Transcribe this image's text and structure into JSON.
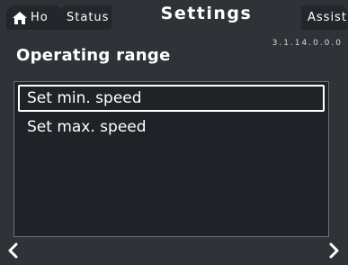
{
  "tabs": {
    "home": "Ho",
    "status": "Status",
    "settings": "Settings",
    "assist": "Assist"
  },
  "version": "3.1.14.0.0.0",
  "page_title": "Operating range",
  "menu_items": [
    {
      "label": "Set min. speed",
      "selected": true
    },
    {
      "label": "Set max. speed",
      "selected": false
    }
  ],
  "icons": {
    "home": "home-icon",
    "back": "chevron-left-icon",
    "forward": "chevron-right-icon"
  },
  "colors": {
    "background": "#2f3338",
    "panel": "#1f2327",
    "tab_inactive": "#23272b",
    "text": "#ffffff"
  }
}
